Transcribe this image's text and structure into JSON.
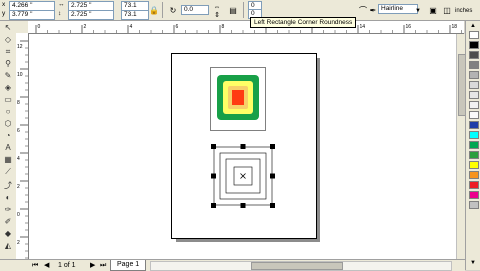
{
  "propbar": {
    "x_value": "4.266 \"",
    "y_value": "3.779 \"",
    "width_value": "2.725 \"",
    "height_value": "2.725 \"",
    "scale_x": "73.1",
    "scale_y": "73.1",
    "angle_value": "0.0",
    "outline_value": "Hairline",
    "corner_top": "0",
    "corner_bottom": "0",
    "inches_label": "inches"
  },
  "tooltip": "Left Rectangle Corner Roundness",
  "hruler_ticks": [
    "0",
    "2",
    "4",
    "6",
    "8",
    "10",
    "12",
    "14",
    "16",
    "18"
  ],
  "vruler_ticks": [
    "12",
    "10",
    "8",
    "6",
    "4",
    "2",
    "0",
    "2"
  ],
  "palette": {
    "colors": [
      "#ffffff",
      "#000000",
      "#4d4d4d",
      "#808080",
      "#b3b3b3",
      "#d9d9d9",
      "#e6e6e6",
      "#f2f2f2",
      "#fafafa",
      "#1e3ca8",
      "#00ffff",
      "#00a651",
      "#2b9f3e",
      "#ffff00",
      "#f7941d",
      "#ed1c24",
      "#ec008c",
      "#c1c1c1"
    ]
  },
  "artwork": {
    "outer_green": "#18a048",
    "middle_yellow": "#ffff66",
    "inner_yellow": "#f7d06a",
    "center_red": "#ff3b12"
  },
  "bottombar": {
    "page_count": "1 of 1",
    "page_tab": "Page 1"
  }
}
